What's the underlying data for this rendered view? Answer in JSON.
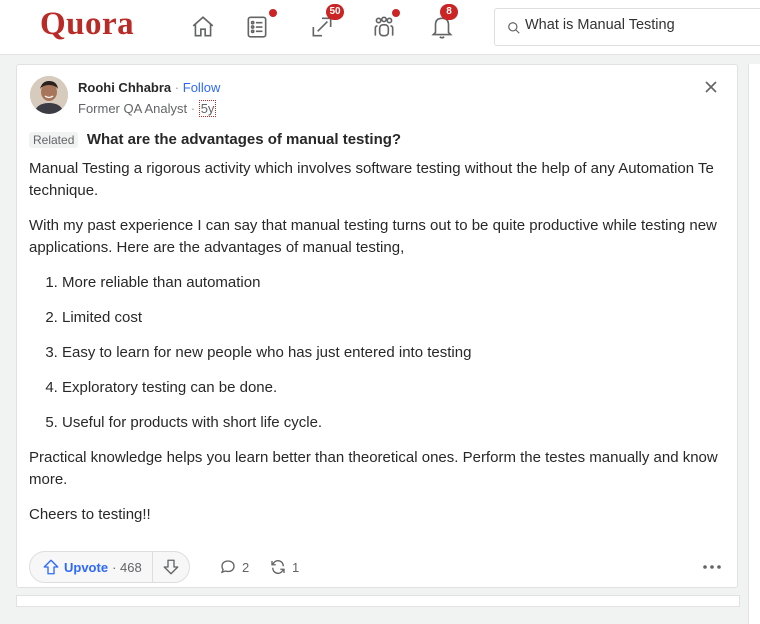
{
  "header": {
    "logo": "Quora",
    "nav": [
      {
        "name": "home",
        "icon": "home-icon",
        "indicator": null
      },
      {
        "name": "following",
        "icon": "following-list-icon",
        "indicator": "dot"
      },
      {
        "name": "answer",
        "icon": "answer-pencil-icon",
        "indicator": "50"
      },
      {
        "name": "spaces",
        "icon": "spaces-icon",
        "indicator": "dot"
      },
      {
        "name": "notifications",
        "icon": "bell-icon",
        "indicator": "8"
      }
    ],
    "badges": {
      "answer": "50",
      "notifications": "8"
    },
    "search": {
      "value": "What is Manual Testing",
      "icon": "search-icon"
    }
  },
  "post": {
    "author": {
      "name": "Roohi Chhabra",
      "follow_label": "Follow",
      "separator": "·",
      "credential": "Former QA Analyst",
      "time": "5y"
    },
    "related_label": "Related",
    "question": "What are the advantages of manual testing?",
    "paragraphs_before": [
      "Manual Testing a rigorous activity which involves software testing without the help of any Automation Te technique.",
      "With my past experience I can say that manual testing turns out to be quite productive while testing new applications. Here are the advantages of manual testing,"
    ],
    "list": [
      "More reliable than automation",
      "Limited cost",
      "Easy to learn for new people who has just entered into testing",
      "Exploratory testing can be done.",
      "Useful for products with short life cycle."
    ],
    "paragraphs_after": [
      "Practical knowledge helps you learn better than theoretical ones. Perform the testes manually and know more.",
      "Cheers to testing!!"
    ],
    "actions": {
      "upvote_label": "Upvote",
      "upvote_count": "· 468",
      "comments": "2",
      "shares": "1"
    }
  },
  "colors": {
    "brand": "#b92b27",
    "accent_blue": "#2e69ff",
    "badge_red": "#cb2425"
  }
}
